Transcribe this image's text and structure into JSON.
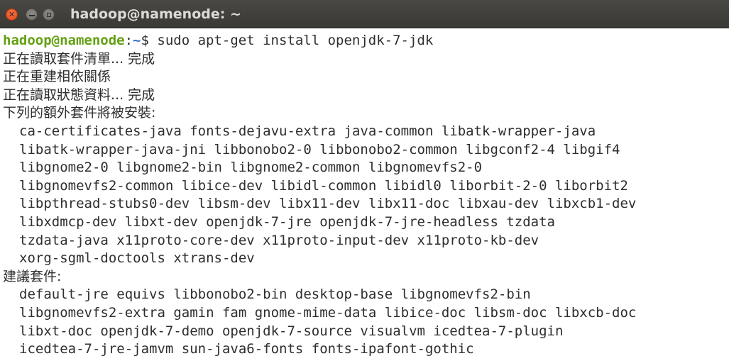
{
  "window": {
    "title": "hadoop@namenode: ~",
    "close_glyph": "✕",
    "min_glyph": "",
    "max_glyph": ""
  },
  "prompt": {
    "user_host": "hadoop@namenode",
    "separator": ":",
    "path": "~",
    "symbol": "$",
    "command": " sudo apt-get install openjdk-7-jdk"
  },
  "output": {
    "status_lines": [
      "正在讀取套件清單... 完成",
      "正在重建相依關係",
      "正在讀取狀態資料... 完成",
      "下列的額外套件將被安裝:"
    ],
    "extra_packages": [
      "ca-certificates-java fonts-dejavu-extra java-common libatk-wrapper-java",
      "libatk-wrapper-java-jni libbonobo2-0 libbonobo2-common libgconf2-4 libgif4",
      "libgnome2-0 libgnome2-bin libgnome2-common libgnomevfs2-0",
      "libgnomevfs2-common libice-dev libidl-common libidl0 liborbit-2-0 liborbit2",
      "libpthread-stubs0-dev libsm-dev libx11-dev libx11-doc libxau-dev libxcb1-dev",
      "libxdmcp-dev libxt-dev openjdk-7-jre openjdk-7-jre-headless tzdata",
      "tzdata-java x11proto-core-dev x11proto-input-dev x11proto-kb-dev",
      "xorg-sgml-doctools xtrans-dev"
    ],
    "suggested_header": "建議套件:",
    "suggested_packages": [
      "default-jre equivs libbonobo2-bin desktop-base libgnomevfs2-bin",
      "libgnomevfs2-extra gamin fam gnome-mime-data libice-doc libsm-doc libxcb-doc",
      "libxt-doc openjdk-7-demo openjdk-7-source visualvm icedtea-7-plugin",
      "icedtea-7-jre-jamvm sun-java6-fonts fonts-ipafont-gothic"
    ]
  },
  "colors": {
    "prompt_user": "#63a012",
    "prompt_path": "#3a6fc7",
    "text": "#2e2e2e",
    "titlebar": "#3b3935",
    "close_button": "#e2461b"
  }
}
